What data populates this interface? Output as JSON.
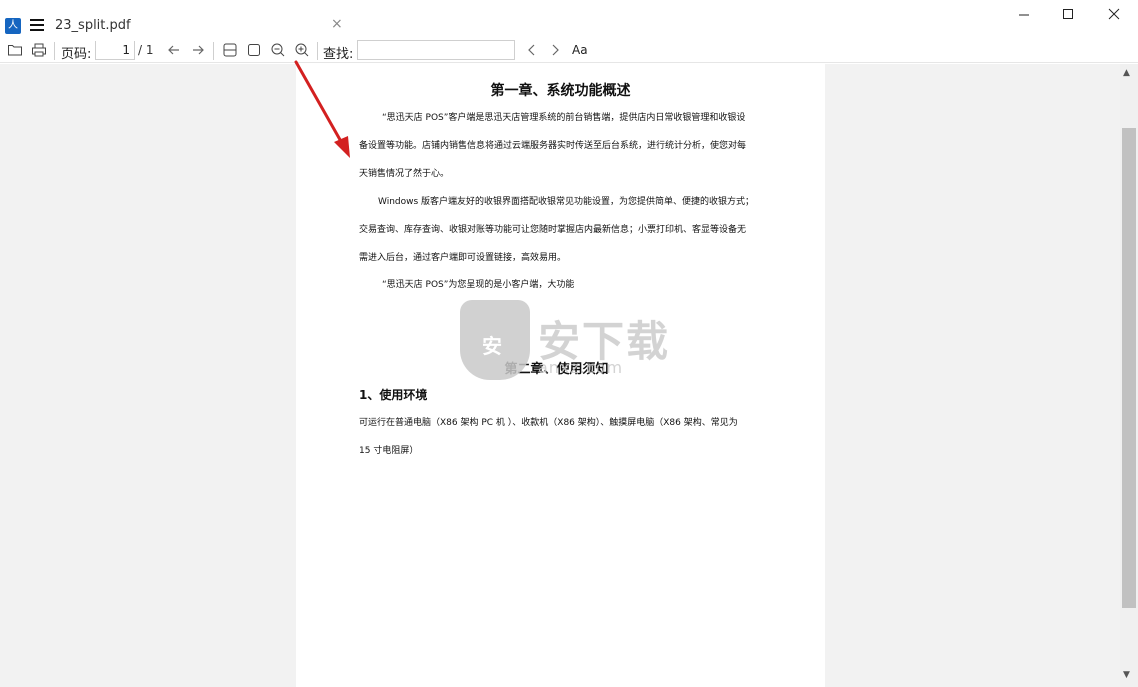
{
  "app": {
    "tab_title": "23_split.pdf",
    "tab_close": "×",
    "logo_glyph": "人"
  },
  "toolbar": {
    "page_label": "页码:",
    "current_page": "1",
    "total_pages": "/ 1",
    "find_label": "查找:",
    "search_value": "",
    "font_toggle": "Aa"
  },
  "document": {
    "chapter1_title": "第一章、系统功能概述",
    "para1_line1": "“思迅天店 POS”客户端是思迅天店管理系统的前台销售端，提供店内日常收银管理和收银设",
    "para1_line2": "备设置等功能。店铺内销售信息将通过云端服务器实时传送至后台系统，进行统计分析，使您对每",
    "para1_line3": "天销售情况了然于心。",
    "para2_line1": "Windows 版客户端友好的收银界面搭配收银常见功能设置，为您提供简单、便捷的收银方式；",
    "para2_line2": "交易查询、库存查询、收银对账等功能可让您随时掌握店内最新信息；小票打印机、客显等设备无",
    "para2_line3": "需进入后台，通过客户端即可设置链接，高效易用。",
    "para3_line1": "“思迅天店 POS”为您呈现的是小客户端，大功能",
    "chapter2_title": "第二章、使用须知",
    "section1_title": "1、使用环境",
    "env_line1": "可运行在普通电脑（X86 架构 PC 机 ）、收款机（X86 架构）、触摸屏电脑（X86 架构、常见为",
    "env_line2": "15 寸电阻屏）"
  },
  "watermark": {
    "shield_glyph": "安",
    "text": "安下载",
    "sub": "anxz.com"
  },
  "colors": {
    "accent": "#1565c0",
    "arrow": "#d32020"
  }
}
